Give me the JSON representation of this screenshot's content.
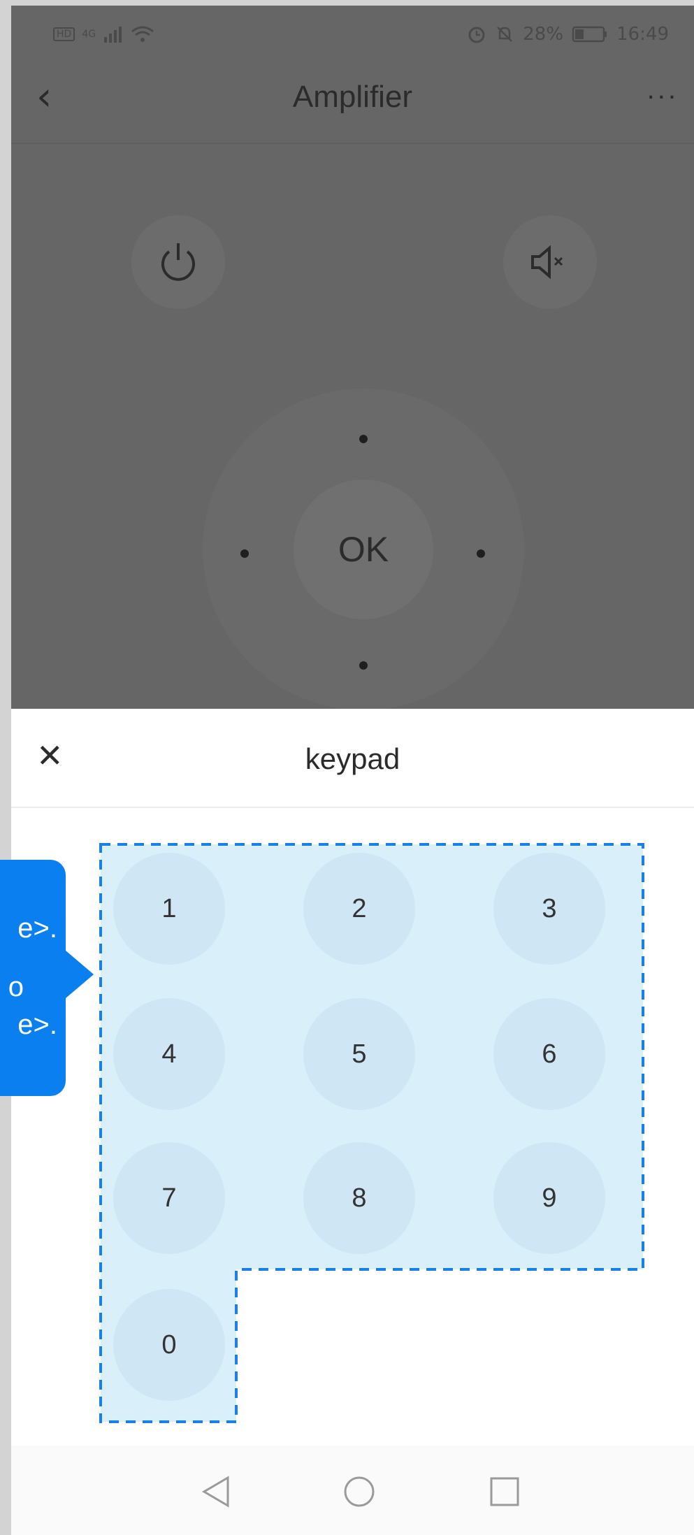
{
  "status_bar": {
    "left_icons": [
      "hd-icon",
      "signal-icon",
      "wifi-icon"
    ],
    "network": "4G",
    "battery": "28%",
    "time": "16:49"
  },
  "nav": {
    "title": "Amplifier",
    "more": "..."
  },
  "remote": {
    "ok_label": "OK"
  },
  "keypad": {
    "title": "keypad",
    "keys": [
      "1",
      "2",
      "3",
      "4",
      "5",
      "6",
      "7",
      "8",
      "9",
      "0"
    ]
  },
  "tooltip": {
    "line1": "e>.",
    "line2": "o",
    "line3": "e>."
  },
  "colors": {
    "highlight_fill": "#d9f0fb",
    "highlight_border": "#1a7fe6",
    "tooltip": "#0a7ff0"
  }
}
